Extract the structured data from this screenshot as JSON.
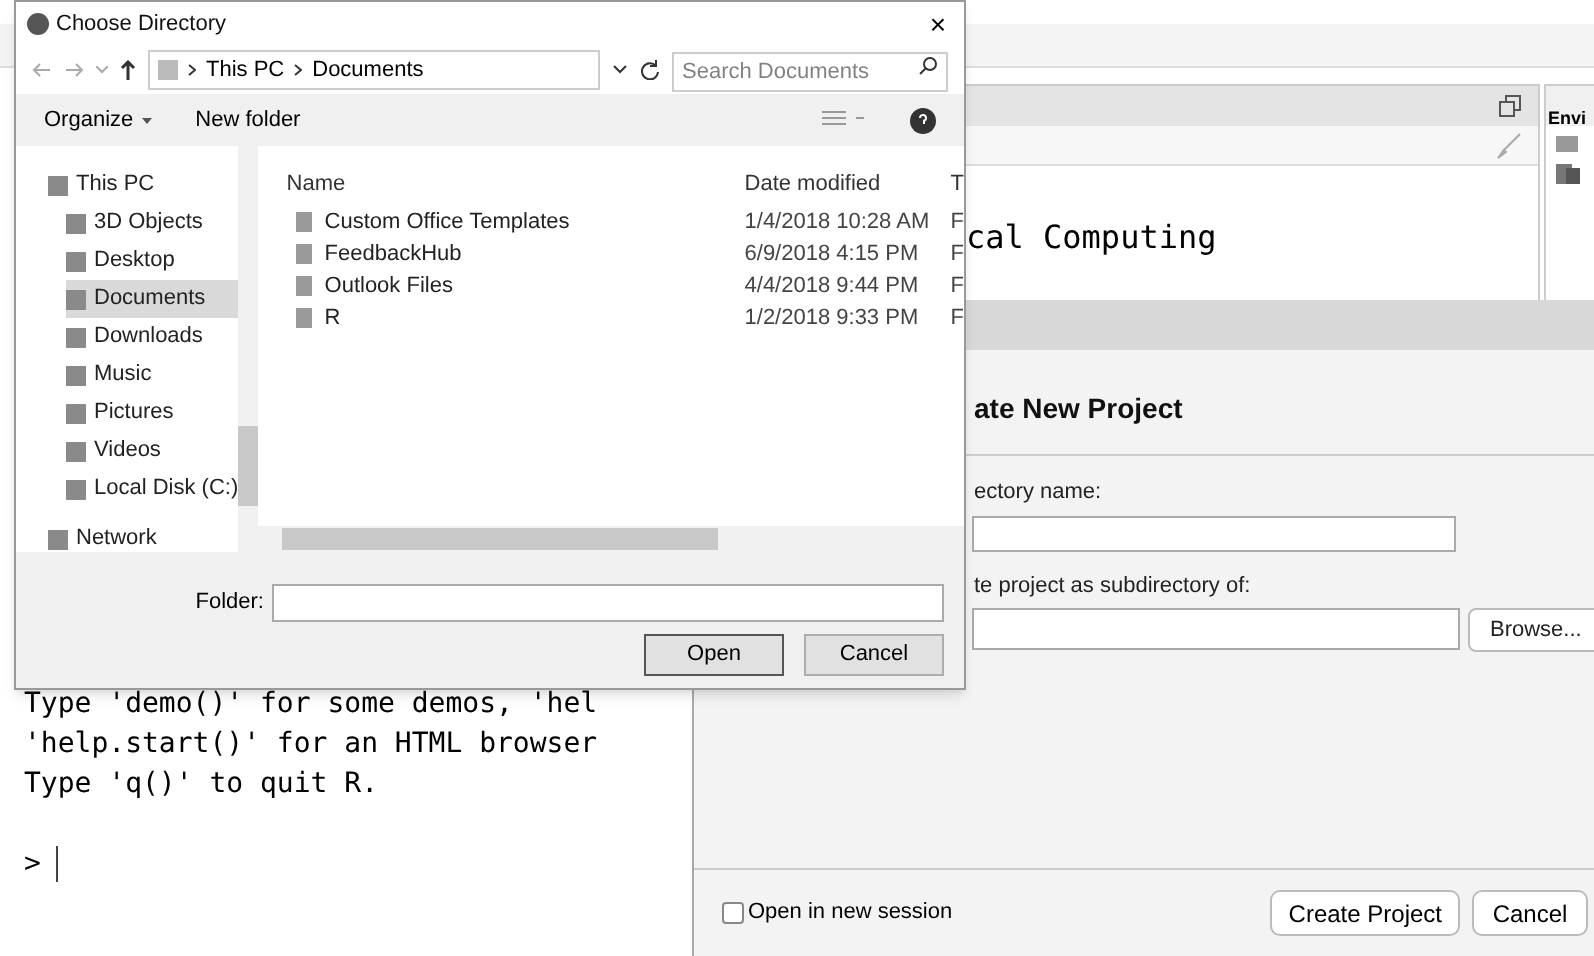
{
  "rstudio": {
    "console_top_text": "cal Computing",
    "environment_tab": "Envi",
    "console_lines": [
      "Type 'demo()' for some demos, 'hel",
      "'help.start()' for an HTML browser",
      "Type 'q()' to quit R."
    ],
    "prompt": ">"
  },
  "choose_directory": {
    "title": "Choose Directory",
    "close": "×",
    "path": [
      "This PC",
      "Documents"
    ],
    "search": {
      "placeholder": "Search Documents"
    },
    "toolbar": [
      "Organize",
      "New folder"
    ],
    "sidebar": [
      {
        "label": "This PC",
        "selected": false,
        "children": [
          {
            "label": "3D Objects",
            "selected": false
          },
          {
            "label": "Desktop",
            "selected": false
          },
          {
            "label": "Documents",
            "selected": true
          },
          {
            "label": "Downloads",
            "selected": false
          },
          {
            "label": "Music",
            "selected": false
          },
          {
            "label": "Pictures",
            "selected": false
          },
          {
            "label": "Videos",
            "selected": false
          },
          {
            "label": "Local Disk (C:)",
            "selected": false
          }
        ]
      },
      {
        "label": "Network",
        "selected": false
      }
    ],
    "columns": [
      "Name",
      "Date modified",
      "T"
    ],
    "rows": [
      {
        "name": "Custom Office Templates",
        "date": "1/4/2018 10:28 AM",
        "column_3": "F"
      },
      {
        "name": "FeedbackHub",
        "date": "6/9/2018 4:15 PM",
        "column_3": "F"
      },
      {
        "name": "Outlook Files",
        "date": "4/4/2018 9:44 PM",
        "column_3": "F"
      },
      {
        "name": "R",
        "date": "1/2/2018 9:33 PM",
        "column_3": "F"
      }
    ],
    "folder_label": "Folder:",
    "buttons": [
      {
        "label": "Open",
        "default": true
      },
      {
        "label": "Cancel",
        "default": false
      }
    ]
  },
  "create_project": {
    "title": "ate New Project",
    "directory_label": "ectory name:",
    "parent_label": "te project as subdirectory of:",
    "browse": "Browse...",
    "new_session": {
      "label": "Open in new session",
      "checked": false
    },
    "buttons": [
      {
        "label": "Create Project"
      },
      {
        "label": "Cancel"
      }
    ]
  }
}
